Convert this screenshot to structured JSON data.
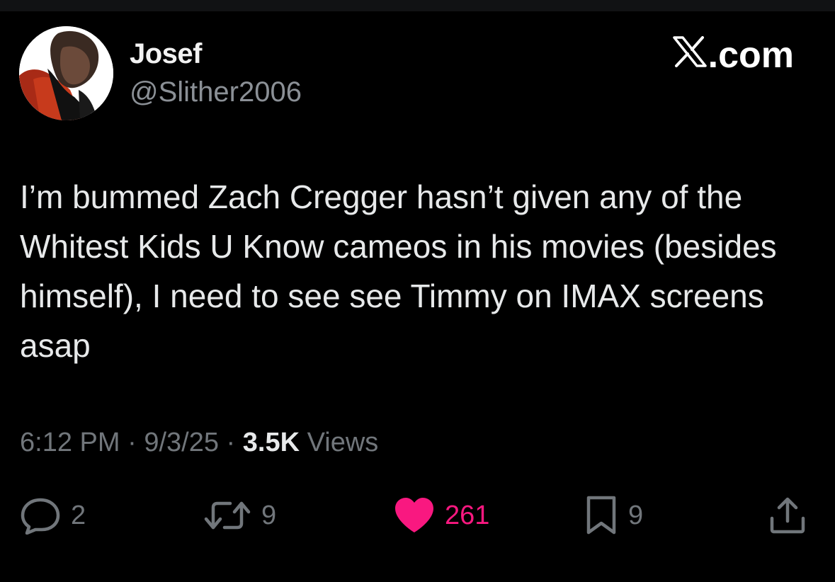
{
  "author": {
    "name": "Josef",
    "handle": "@Slither2006"
  },
  "brand": {
    "label": ".com",
    "icon": "x-logo-icon"
  },
  "tweet": {
    "text": "I’m bummed Zach Cregger hasn’t given any of the Whitest Kids U Know cameos in his movies (besides himself), I need to see see Timmy on IMAX screens asap"
  },
  "meta": {
    "time": "6:12 PM",
    "separator": "·",
    "date": "9/3/25",
    "views_count": "3.5K",
    "views_label": "Views"
  },
  "actions": {
    "replies": "2",
    "reposts": "9",
    "likes": "261",
    "bookmarks": "9"
  },
  "colors": {
    "background": "#000000",
    "text": "#e7e9ea",
    "secondary": "#71767b",
    "like": "#f91880"
  }
}
